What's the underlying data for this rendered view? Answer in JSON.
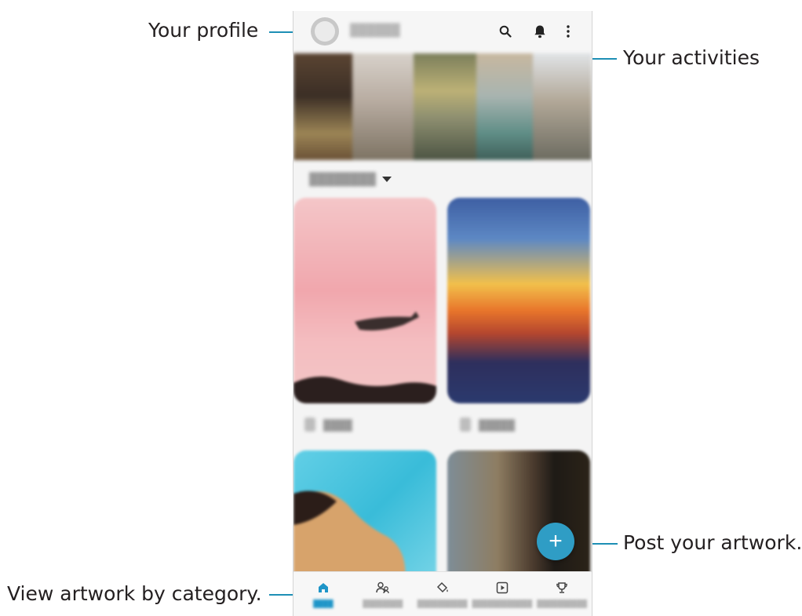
{
  "callouts": {
    "profile": "Your profile",
    "activities": "Your activities",
    "post": "Post your artwork.",
    "category": "View artwork by category."
  },
  "colors": {
    "accent": "#2f9dc5",
    "callout_line": "#1d8fb5"
  },
  "topbar": {
    "icons": [
      "avatar",
      "search-icon",
      "bell-icon",
      "more-vertical-icon"
    ]
  },
  "fab": {
    "label": "+"
  },
  "navbar": {
    "icons": [
      "home-icon",
      "people-icon",
      "paint-bucket-icon",
      "play-square-icon",
      "trophy-icon"
    ],
    "active_index": 0
  }
}
